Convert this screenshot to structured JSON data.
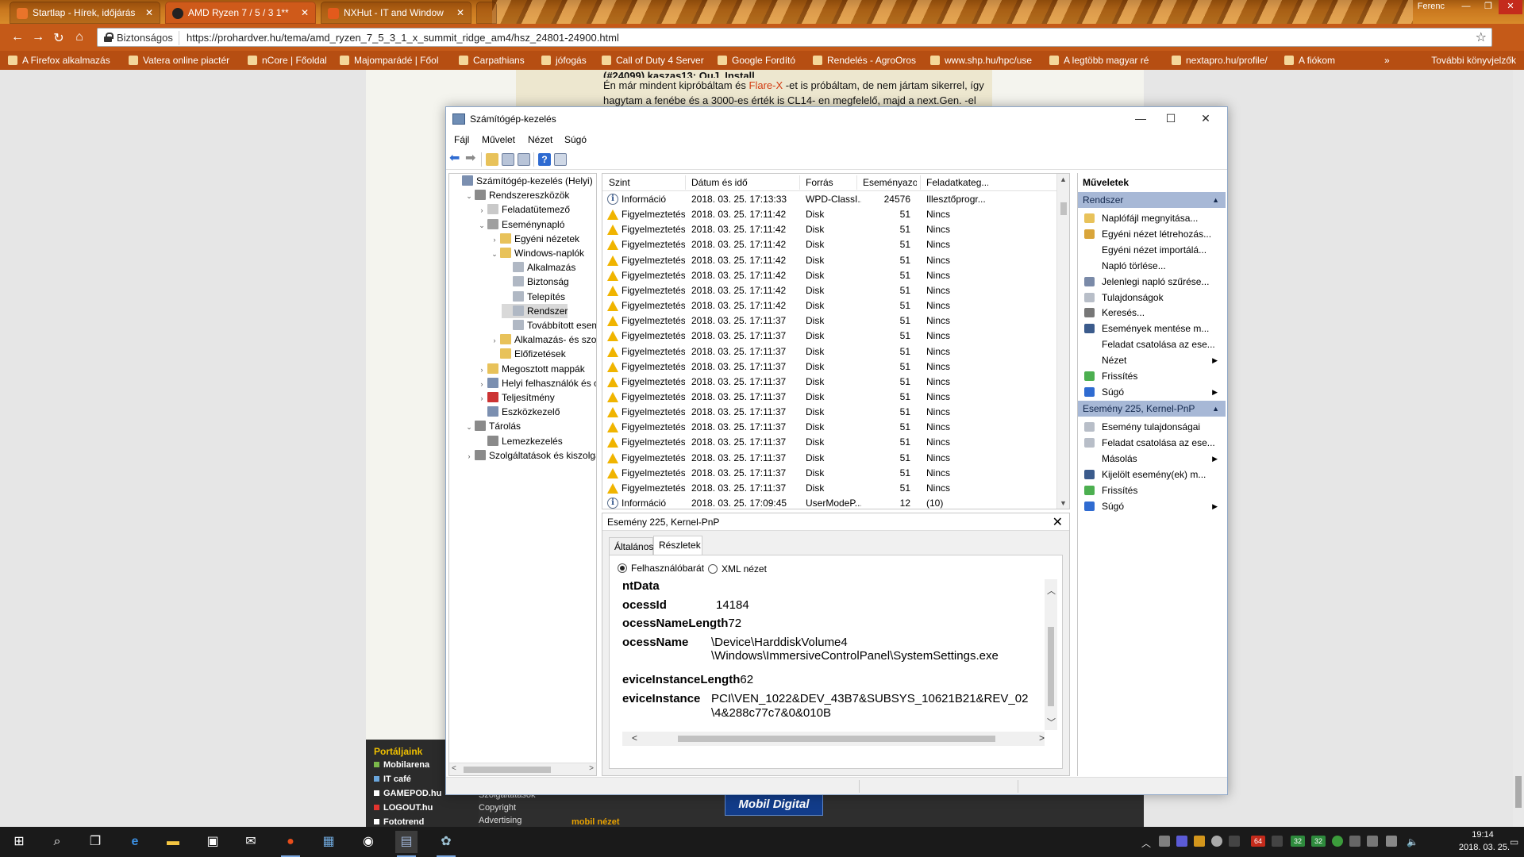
{
  "browser": {
    "tabs": [
      {
        "label": "Startlap - Hírek, időjárás"
      },
      {
        "label": "AMD Ryzen 7 / 5 / 3 1**"
      },
      {
        "label": "NXHut - IT and Window"
      }
    ],
    "user": "Ferenc",
    "secure_label": "Biztonságos",
    "url": "https://prohardver.hu/tema/amd_ryzen_7_5_3_1_x_summit_ridge_am4/hsz_24801-24900.html",
    "bookmarks": [
      "A Firefox alkalmazás",
      "Vatera online piactér",
      "nCore | Főoldal",
      "Majomparádé | Főol",
      "Carpathians",
      "jófogás",
      "Call of Duty 4 Server",
      "Google Fordító",
      "Rendelés - AgroOros",
      "www.shp.hu/hpc/use",
      "A legtöbb magyar ré",
      "nextapro.hu/profile/",
      "A fiókom"
    ],
    "bookmarks_more": "»",
    "bookmarks_other": "További könyvjelzők"
  },
  "website": {
    "post_partial": "(#24099) kaszas13: OuJ. Install...",
    "post_line1_a": "Én már mindent kipróbáltam és ",
    "post_line1_link": "Flare-X",
    "post_line1_b": " -et is próbáltam, de nem jártam sikerrel, így",
    "post_line2": "hagytam a fenébe és a 3000-es érték is CL14- en megfelelő, majd a next.Gen. -el",
    "portals_heading": "Portáljaink",
    "portals": [
      "Mobilarena",
      "IT café",
      "GAMEPOD.hu",
      "LOGOUT.hu",
      "Fototrend"
    ],
    "portal_colors": [
      "#7bb84a",
      "#6aa6dc",
      "#ffffff",
      "#e3342f",
      "#ffffff"
    ],
    "footer_links": [
      "Szolgáltatások",
      "Copyright",
      "Advertising"
    ],
    "banner": "Mobil Digital",
    "mobile_view": "mobil nézet"
  },
  "mmc": {
    "title": "Számítógép-kezelés",
    "menu": [
      "Fájl",
      "Művelet",
      "Nézet",
      "Súgó"
    ],
    "tree": [
      {
        "label": "Számítógép-kezelés (Helyi)",
        "level": 0,
        "exp": "",
        "icon": "#7b8fb0"
      },
      {
        "label": "Rendszereszközök",
        "level": 1,
        "exp": "v",
        "icon": "#8a8a8a"
      },
      {
        "label": "Feladatütemező",
        "level": 2,
        "exp": ">",
        "icon": "#c9c9c9"
      },
      {
        "label": "Eseménynapló",
        "level": 2,
        "exp": "v",
        "icon": "#a0a0a0"
      },
      {
        "label": "Egyéni nézetek",
        "level": 3,
        "exp": ">",
        "icon": "#e8c25a"
      },
      {
        "label": "Windows-naplók",
        "level": 3,
        "exp": "v",
        "icon": "#e8c25a"
      },
      {
        "label": "Alkalmazás",
        "level": 4,
        "exp": "",
        "icon": "#b0b8c4"
      },
      {
        "label": "Biztonság",
        "level": 4,
        "exp": "",
        "icon": "#b0b8c4"
      },
      {
        "label": "Telepítés",
        "level": 4,
        "exp": "",
        "icon": "#b0b8c4"
      },
      {
        "label": "Rendszer",
        "level": 4,
        "exp": "",
        "icon": "#b0b8c4",
        "selected": true
      },
      {
        "label": "Továbbított esem",
        "level": 4,
        "exp": "",
        "icon": "#b0b8c4"
      },
      {
        "label": "Alkalmazás- és szolg",
        "level": 3,
        "exp": ">",
        "icon": "#e8c25a"
      },
      {
        "label": "Előfizetések",
        "level": 3,
        "exp": "",
        "icon": "#e8c25a"
      },
      {
        "label": "Megosztott mappák",
        "level": 2,
        "exp": ">",
        "icon": "#e8c25a"
      },
      {
        "label": "Helyi felhasználók és cs",
        "level": 2,
        "exp": ">",
        "icon": "#7b8fb0"
      },
      {
        "label": "Teljesítmény",
        "level": 2,
        "exp": ">",
        "icon": "#c33"
      },
      {
        "label": "Eszközkezelő",
        "level": 2,
        "exp": "",
        "icon": "#7b8fb0"
      },
      {
        "label": "Tárolás",
        "level": 1,
        "exp": "v",
        "icon": "#8a8a8a"
      },
      {
        "label": "Lemezkezelés",
        "level": 2,
        "exp": "",
        "icon": "#8a8a8a"
      },
      {
        "label": "Szolgáltatások és kiszolgáló",
        "level": 1,
        "exp": ">",
        "icon": "#8a8a8a"
      }
    ],
    "columns": [
      "Szint",
      "Dátum és idő",
      "Forrás",
      "Eseményazo...",
      "Feladatkateg..."
    ],
    "events": [
      {
        "level": "Információ",
        "type": "info",
        "date": "2018. 03. 25. 17:13:33",
        "source": "WPD-ClassI...",
        "id": "24576",
        "cat": "Illesztőprogr..."
      },
      {
        "level": "Figyelmeztetés",
        "type": "warn",
        "date": "2018. 03. 25. 17:11:42",
        "source": "Disk",
        "id": "51",
        "cat": "Nincs"
      },
      {
        "level": "Figyelmeztetés",
        "type": "warn",
        "date": "2018. 03. 25. 17:11:42",
        "source": "Disk",
        "id": "51",
        "cat": "Nincs"
      },
      {
        "level": "Figyelmeztetés",
        "type": "warn",
        "date": "2018. 03. 25. 17:11:42",
        "source": "Disk",
        "id": "51",
        "cat": "Nincs"
      },
      {
        "level": "Figyelmeztetés",
        "type": "warn",
        "date": "2018. 03. 25. 17:11:42",
        "source": "Disk",
        "id": "51",
        "cat": "Nincs"
      },
      {
        "level": "Figyelmeztetés",
        "type": "warn",
        "date": "2018. 03. 25. 17:11:42",
        "source": "Disk",
        "id": "51",
        "cat": "Nincs"
      },
      {
        "level": "Figyelmeztetés",
        "type": "warn",
        "date": "2018. 03. 25. 17:11:42",
        "source": "Disk",
        "id": "51",
        "cat": "Nincs"
      },
      {
        "level": "Figyelmeztetés",
        "type": "warn",
        "date": "2018. 03. 25. 17:11:42",
        "source": "Disk",
        "id": "51",
        "cat": "Nincs"
      },
      {
        "level": "Figyelmeztetés",
        "type": "warn",
        "date": "2018. 03. 25. 17:11:37",
        "source": "Disk",
        "id": "51",
        "cat": "Nincs"
      },
      {
        "level": "Figyelmeztetés",
        "type": "warn",
        "date": "2018. 03. 25. 17:11:37",
        "source": "Disk",
        "id": "51",
        "cat": "Nincs"
      },
      {
        "level": "Figyelmeztetés",
        "type": "warn",
        "date": "2018. 03. 25. 17:11:37",
        "source": "Disk",
        "id": "51",
        "cat": "Nincs"
      },
      {
        "level": "Figyelmeztetés",
        "type": "warn",
        "date": "2018. 03. 25. 17:11:37",
        "source": "Disk",
        "id": "51",
        "cat": "Nincs"
      },
      {
        "level": "Figyelmeztetés",
        "type": "warn",
        "date": "2018. 03. 25. 17:11:37",
        "source": "Disk",
        "id": "51",
        "cat": "Nincs"
      },
      {
        "level": "Figyelmeztetés",
        "type": "warn",
        "date": "2018. 03. 25. 17:11:37",
        "source": "Disk",
        "id": "51",
        "cat": "Nincs"
      },
      {
        "level": "Figyelmeztetés",
        "type": "warn",
        "date": "2018. 03. 25. 17:11:37",
        "source": "Disk",
        "id": "51",
        "cat": "Nincs"
      },
      {
        "level": "Figyelmeztetés",
        "type": "warn",
        "date": "2018. 03. 25. 17:11:37",
        "source": "Disk",
        "id": "51",
        "cat": "Nincs"
      },
      {
        "level": "Figyelmeztetés",
        "type": "warn",
        "date": "2018. 03. 25. 17:11:37",
        "source": "Disk",
        "id": "51",
        "cat": "Nincs"
      },
      {
        "level": "Figyelmeztetés",
        "type": "warn",
        "date": "2018. 03. 25. 17:11:37",
        "source": "Disk",
        "id": "51",
        "cat": "Nincs"
      },
      {
        "level": "Figyelmeztetés",
        "type": "warn",
        "date": "2018. 03. 25. 17:11:37",
        "source": "Disk",
        "id": "51",
        "cat": "Nincs"
      },
      {
        "level": "Figyelmeztetés",
        "type": "warn",
        "date": "2018. 03. 25. 17:11:37",
        "source": "Disk",
        "id": "51",
        "cat": "Nincs"
      },
      {
        "level": "Információ",
        "type": "info",
        "date": "2018. 03. 25. 17:09:45",
        "source": "UserModeP...",
        "id": "12",
        "cat": "(10)"
      }
    ],
    "detail": {
      "title": "Esemény 225, Kernel-PnP",
      "tabs": [
        "Általános",
        "Részletek"
      ],
      "radio_friendly": "Felhasználóbarát",
      "radio_xml": "XML nézet",
      "section": "ntData",
      "rows": [
        {
          "key": "ocessId",
          "value": "14184"
        },
        {
          "key": "ocessNameLength",
          "value": "72"
        },
        {
          "key": "ocessName",
          "value": "\\Device\\HarddiskVolume4"
        },
        {
          "key": "",
          "value": "\\Windows\\ImmersiveControlPanel\\SystemSettings.exe"
        },
        {
          "key": "eviceInstanceLength",
          "value": "62"
        },
        {
          "key": "eviceInstance",
          "value": "PCI\\VEN_1022&DEV_43B7&SUBSYS_10621B21&REV_02"
        },
        {
          "key": "",
          "value": "\\4&288c77c7&0&010B"
        }
      ]
    },
    "actions_title": "Műveletek",
    "group1": "Rendszer",
    "group1_items": [
      {
        "label": "Naplófájl megnyitása...",
        "icon": "#e8c25a"
      },
      {
        "label": "Egyéni nézet létrehozás...",
        "icon": "#d9a53a"
      },
      {
        "label": "Egyéni nézet importálá...",
        "icon": ""
      },
      {
        "label": "Napló törlése...",
        "icon": ""
      },
      {
        "label": "Jelenlegi napló szűrése...",
        "icon": "#7a8aa8"
      },
      {
        "label": "Tulajdonságok",
        "icon": "#b8bec8"
      },
      {
        "label": "Keresés...",
        "icon": "#777"
      },
      {
        "label": "Események mentése m...",
        "icon": "#3b5b8c"
      },
      {
        "label": "Feladat csatolása az ese...",
        "icon": ""
      },
      {
        "label": "Nézet",
        "icon": "",
        "sub": true
      },
      {
        "label": "Frissítés",
        "icon": "#4caf50"
      },
      {
        "label": "Súgó",
        "icon": "#2f6bd1",
        "sub": true
      }
    ],
    "group2": "Esemény 225, Kernel-PnP",
    "group2_items": [
      {
        "label": "Esemény tulajdonságai",
        "icon": "#b8bec8"
      },
      {
        "label": "Feladat csatolása az ese...",
        "icon": "#b8bec8"
      },
      {
        "label": "Másolás",
        "icon": "",
        "sub": true
      },
      {
        "label": "Kijelölt esemény(ek) m...",
        "icon": "#3b5b8c"
      },
      {
        "label": "Frissítés",
        "icon": "#4caf50"
      },
      {
        "label": "Súgó",
        "icon": "#2f6bd1",
        "sub": true
      }
    ]
  },
  "taskbar": {
    "tray_badges": [
      "64",
      "32",
      "32"
    ],
    "time": "19:14",
    "date": "2018. 03. 25."
  }
}
